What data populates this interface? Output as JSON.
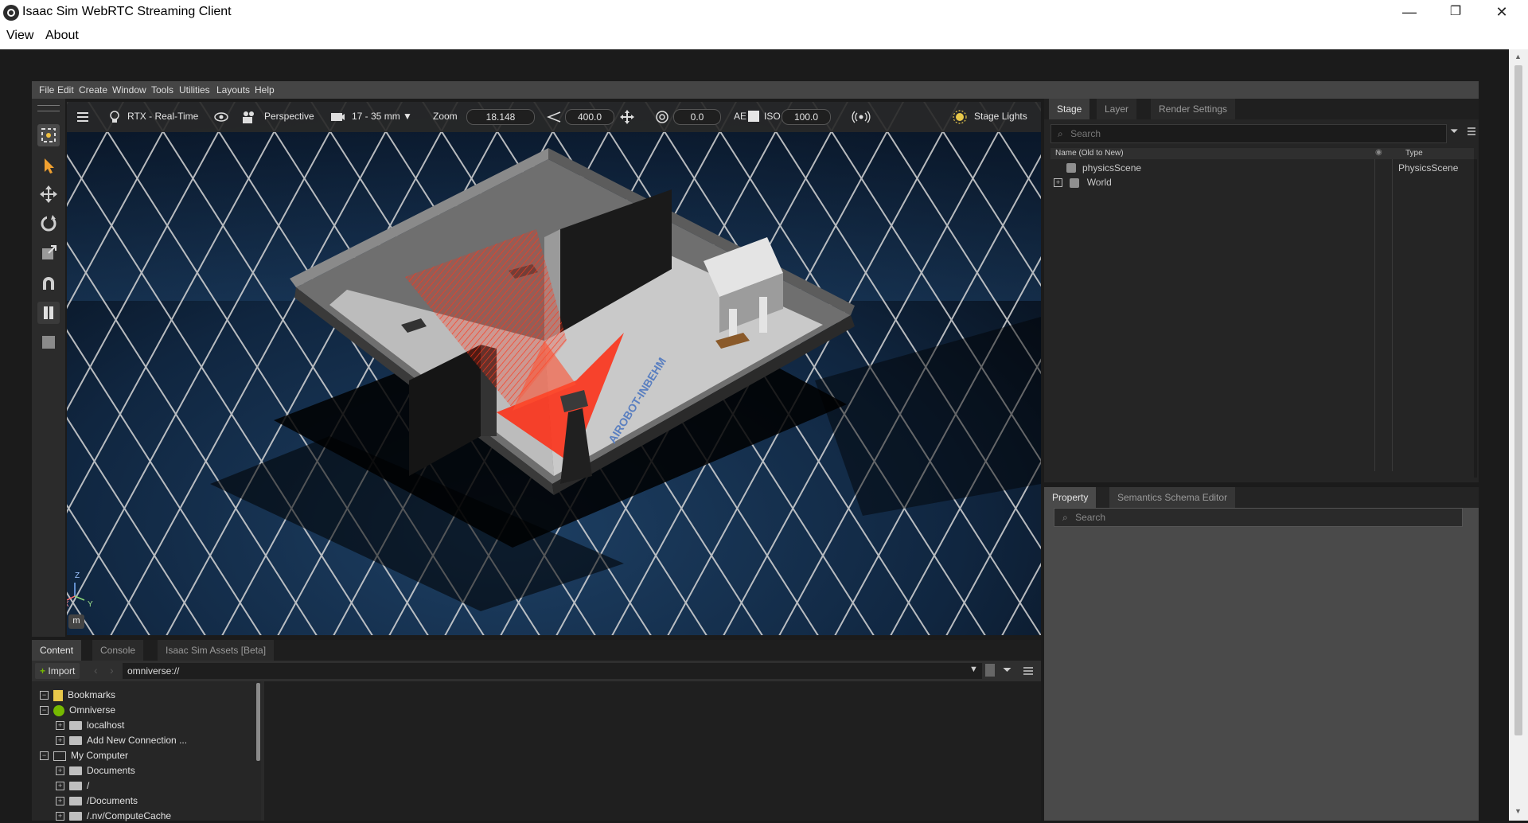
{
  "window": {
    "title": "Isaac Sim WebRTC Streaming Client",
    "menu": [
      "View",
      "About"
    ],
    "controls": {
      "minimize": "—",
      "maximize": "❐",
      "close": "✕"
    }
  },
  "isaac_menu": [
    "File",
    "Edit",
    "Create",
    "Window",
    "Tools",
    "Utilities",
    "Layouts",
    "Help"
  ],
  "viewport_bar": {
    "renderer": "RTX - Real-Time",
    "camera": "Perspective",
    "lens": "17 - 35 mm",
    "zoom_label": "Zoom",
    "zoom_value": "18.148",
    "fov_value": "400.0",
    "exposure_value": "0.0",
    "ae_label": "AE",
    "iso_label": "ISO",
    "iso_value": "100.0",
    "stage_lights": "Stage Lights"
  },
  "viewport_overlay": {
    "axis_x": "X",
    "axis_y": "Y",
    "axis_z": "Z",
    "m_badge": "m",
    "floor_text": "AIROBOT-INBEHM"
  },
  "stage": {
    "tabs": [
      "Stage",
      "Layer",
      "Render Settings"
    ],
    "search_placeholder": "Search",
    "col_name": "Name (Old to New)",
    "col_type": "Type",
    "rows": [
      {
        "name": "physicsScene",
        "type": "PhysicsScene"
      },
      {
        "name": "World",
        "type": ""
      }
    ]
  },
  "property": {
    "tabs": [
      "Property",
      "Semantics Schema Editor"
    ],
    "search_placeholder": "Search"
  },
  "content": {
    "tabs": [
      "Content",
      "Console",
      "Isaac Sim Assets [Beta]"
    ],
    "import_label": "Import",
    "path": "omniverse://",
    "tree": [
      {
        "label": "Bookmarks"
      },
      {
        "label": "Omniverse"
      },
      {
        "label": "localhost"
      },
      {
        "label": "Add New Connection ..."
      },
      {
        "label": "My Computer"
      },
      {
        "label": "Documents"
      },
      {
        "label": "/"
      },
      {
        "label": "/Documents"
      },
      {
        "label": "/.nv/ComputeCache"
      }
    ]
  },
  "colors": {
    "accent": "#f0c040",
    "laser": "#ff2a10",
    "panel": "#252525"
  }
}
